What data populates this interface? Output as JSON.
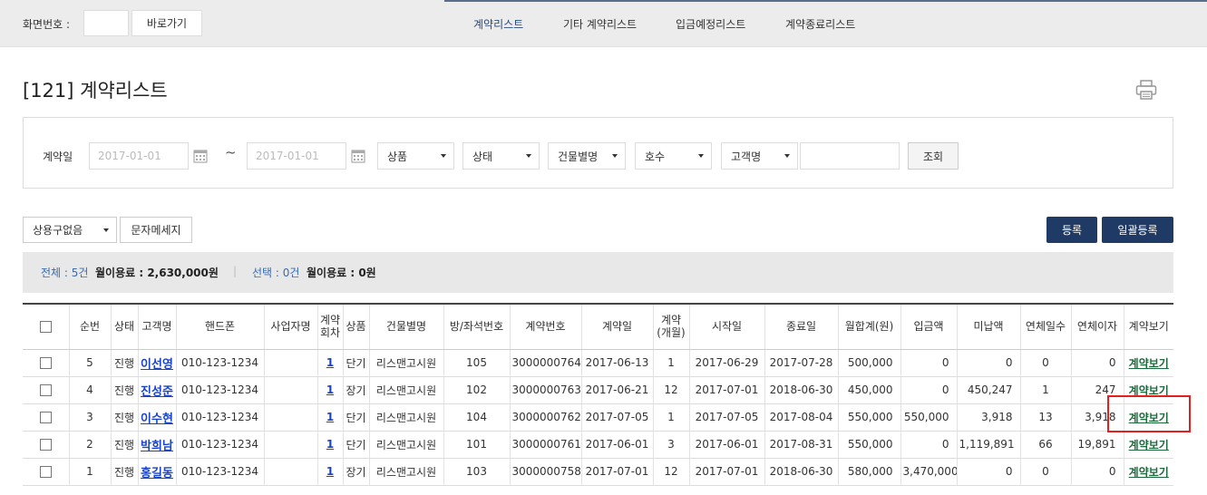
{
  "topbar": {
    "screen_label": "화면번호 :",
    "screen_input_value": "",
    "goto_label": "바로가기",
    "tabs": [
      {
        "label": "계약리스트",
        "active": true
      },
      {
        "label": "기타 계약리스트",
        "active": false
      },
      {
        "label": "입금예정리스트",
        "active": false
      },
      {
        "label": "계약종료리스트",
        "active": false
      }
    ]
  },
  "page": {
    "title": "[121] 계약리스트",
    "print_icon": "printer-icon"
  },
  "filter": {
    "label": "계약일",
    "date_from": "2017-01-01",
    "tilde": "~",
    "date_to": "2017-01-01",
    "selects": [
      "상품",
      "상태",
      "건물별명",
      "호수",
      "고객명"
    ],
    "name_value": "",
    "search_label": "조회"
  },
  "actions": {
    "usage_select": "상용구없음",
    "sms_label": "문자메세지",
    "register_label": "등록",
    "bulk_register_label": "일괄등록"
  },
  "summary": {
    "total_label": "전체 : 5건",
    "total_fee": "월이용료 : 2,630,000원",
    "separator": "|",
    "selected_label": "선택 : 0건",
    "selected_fee": "월이용료 : 0원"
  },
  "table": {
    "headers": [
      "",
      "순번",
      "상태",
      "고객명",
      "핸드폰",
      "사업자명",
      "계약\n회차",
      "상품",
      "건물별명",
      "방/좌석번호",
      "계약번호",
      "계약일",
      "계약\n(개월)",
      "시작일",
      "종료일",
      "월합계(원)",
      "입금액",
      "미납액",
      "연체일수",
      "연체이자",
      "계약보기"
    ],
    "rows": [
      {
        "no": "5",
        "status": "진행",
        "name": "이선영",
        "phone": "010-123-1234",
        "biz": "",
        "round": "1",
        "product": "단기",
        "building": "리스맨고시원",
        "room": "105",
        "contract_no": "3000000764",
        "contract_date": "2017-06-13",
        "months": "1",
        "start": "2017-06-29",
        "end": "2017-07-28",
        "monthly": "500,000",
        "paid": "0",
        "unpaid": "0",
        "overdue_days": "0",
        "overdue_interest": "0",
        "view": "계약보기"
      },
      {
        "no": "4",
        "status": "진행",
        "name": "진성준",
        "phone": "010-123-1234",
        "biz": "",
        "round": "1",
        "product": "장기",
        "building": "리스맨고시원",
        "room": "102",
        "contract_no": "3000000763",
        "contract_date": "2017-06-21",
        "months": "12",
        "start": "2017-07-01",
        "end": "2018-06-30",
        "monthly": "450,000",
        "paid": "0",
        "unpaid": "450,247",
        "overdue_days": "1",
        "overdue_interest": "247",
        "view": "계약보기"
      },
      {
        "no": "3",
        "status": "진행",
        "name": "이수현",
        "phone": "010-123-1234",
        "biz": "",
        "round": "1",
        "product": "단기",
        "building": "리스맨고시원",
        "room": "104",
        "contract_no": "3000000762",
        "contract_date": "2017-07-05",
        "months": "1",
        "start": "2017-07-05",
        "end": "2017-08-04",
        "monthly": "550,000",
        "paid": "550,000",
        "unpaid": "3,918",
        "overdue_days": "13",
        "overdue_interest": "3,918",
        "view": "계약보기"
      },
      {
        "no": "2",
        "status": "진행",
        "name": "박희남",
        "phone": "010-123-1234",
        "biz": "",
        "round": "1",
        "product": "단기",
        "building": "리스맨고시원",
        "room": "101",
        "contract_no": "3000000761",
        "contract_date": "2017-06-01",
        "months": "3",
        "start": "2017-06-01",
        "end": "2017-08-31",
        "monthly": "550,000",
        "paid": "0",
        "unpaid": "1,119,891",
        "overdue_days": "66",
        "overdue_interest": "19,891",
        "view": "계약보기"
      },
      {
        "no": "1",
        "status": "진행",
        "name": "홍길동",
        "phone": "010-123-1234",
        "biz": "",
        "round": "1",
        "product": "장기",
        "building": "리스맨고시원",
        "room": "103",
        "contract_no": "3000000758",
        "contract_date": "2017-07-01",
        "months": "12",
        "start": "2017-07-01",
        "end": "2018-06-30",
        "monthly": "580,000",
        "paid": "3,470,000",
        "unpaid": "0",
        "overdue_days": "0",
        "overdue_interest": "0",
        "view": "계약보기"
      }
    ]
  },
  "colors": {
    "nav_active": "#2b4a7e",
    "navy_button": "#1f3a64",
    "link_blue": "#1a44c8",
    "view_link_green": "#1d6b3c",
    "highlight_red": "#e32020"
  }
}
